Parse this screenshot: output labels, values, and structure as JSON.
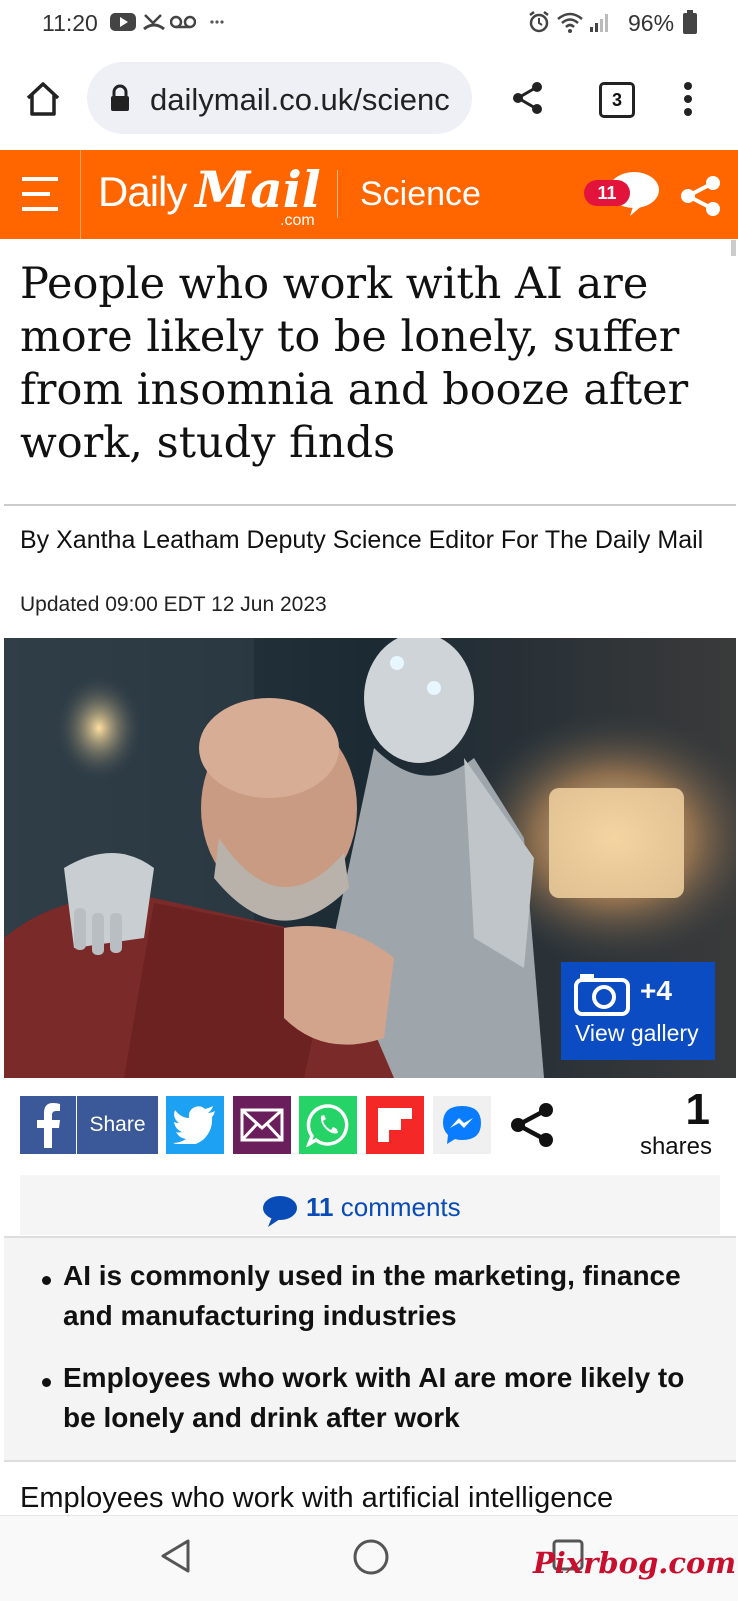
{
  "status_bar": {
    "time": "11:20",
    "icons": [
      "youtube-icon",
      "missed-call-icon",
      "voicemail-icon",
      "more-notifications-icon",
      "alarm-icon",
      "wifi-icon",
      "signal-icon",
      "battery-icon"
    ],
    "battery": "96%"
  },
  "browser": {
    "url": "dailymail.co.uk/scienc",
    "tab_count": "3",
    "icons": [
      "home-icon",
      "lock-icon",
      "share-icon",
      "tabs-icon",
      "menu-icon"
    ]
  },
  "header": {
    "logo_daily": "Daily",
    "logo_mail": "Mail",
    "logo_com": ".com",
    "section": "Science",
    "comment_count": "11",
    "brand_color": "#ff6600"
  },
  "article": {
    "headline": "People who work with AI are more likely to be lonely, suffer from insomnia and booze after work, study finds",
    "byline": "By Xantha Leatham Deputy Science Editor For The Daily Mail",
    "updated": "Updated 09:00 EDT 12 Jun 2023",
    "gallery_count": "+4",
    "gallery_label": "View gallery",
    "bullets": [
      "AI is commonly used in the marketing, finance and manufacturing industries",
      "Employees who work with AI are more likely to be lonely and drink after work"
    ],
    "body_start": "Employees who work with artificial intelligence"
  },
  "share_bar": {
    "facebook_label": "Share",
    "share_count": "1",
    "share_label": "shares",
    "buttons": [
      "facebook-icon",
      "twitter-icon",
      "email-icon",
      "whatsapp-icon",
      "flipboard-icon",
      "messenger-icon",
      "share-icon"
    ]
  },
  "comments": {
    "count": "11",
    "label": "comments"
  },
  "watermark": "Pixrbog.com"
}
